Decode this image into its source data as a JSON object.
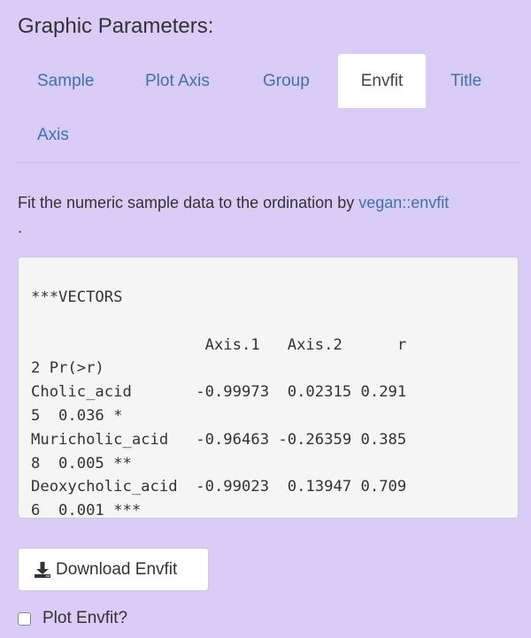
{
  "heading": "Graphic Parameters:",
  "tabs": [
    {
      "label": "Sample",
      "active": false
    },
    {
      "label": "Plot Axis",
      "active": false
    },
    {
      "label": "Group",
      "active": false
    },
    {
      "label": "Envfit",
      "active": true
    },
    {
      "label": "Title",
      "active": false
    },
    {
      "label": "Axis",
      "active": false
    }
  ],
  "description": {
    "text": "Fit the numeric sample data to the ordination by ",
    "link": "vegan::envfit",
    "trailing": "."
  },
  "output": {
    "text": "***VECTORS\n\n                   Axis.1   Axis.2      r\n2 Pr(>r)\nCholic_acid       -0.99973  0.02315 0.291\n5  0.036 *\nMuricholic_acid   -0.96463 -0.26359 0.385\n8  0.005 **\nDeoxycholic_acid  -0.99023  0.13947 0.709\n6  0.001 ***"
  },
  "download_button": {
    "label": "Download Envfit",
    "icon": "download-icon"
  },
  "plot_envfit": {
    "label": "Plot Envfit?",
    "checked": false
  },
  "colors": {
    "background": "#d9ccf6",
    "link": "#3d72b4",
    "active_tab": "#ffffff"
  }
}
